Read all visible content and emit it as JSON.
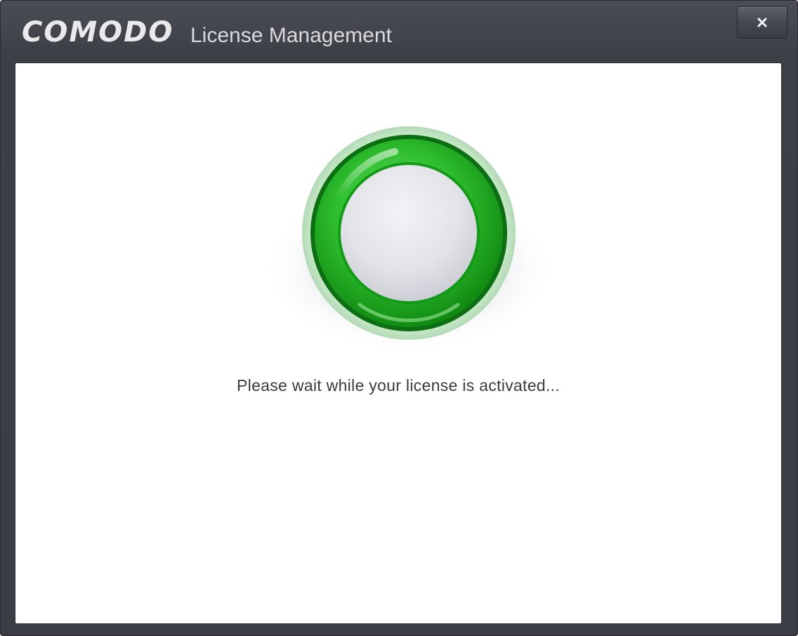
{
  "window": {
    "brand": "COMODO",
    "title": "License Management",
    "close_icon": "close-icon"
  },
  "main": {
    "indicator_icon": "status-ring-icon",
    "status_message": "Please wait while your license is activated..."
  },
  "colors": {
    "titlebar": "#3c3f46",
    "ring_green": "#2fbf2f",
    "content_bg": "#ffffff",
    "text": "#3a3a3a"
  }
}
